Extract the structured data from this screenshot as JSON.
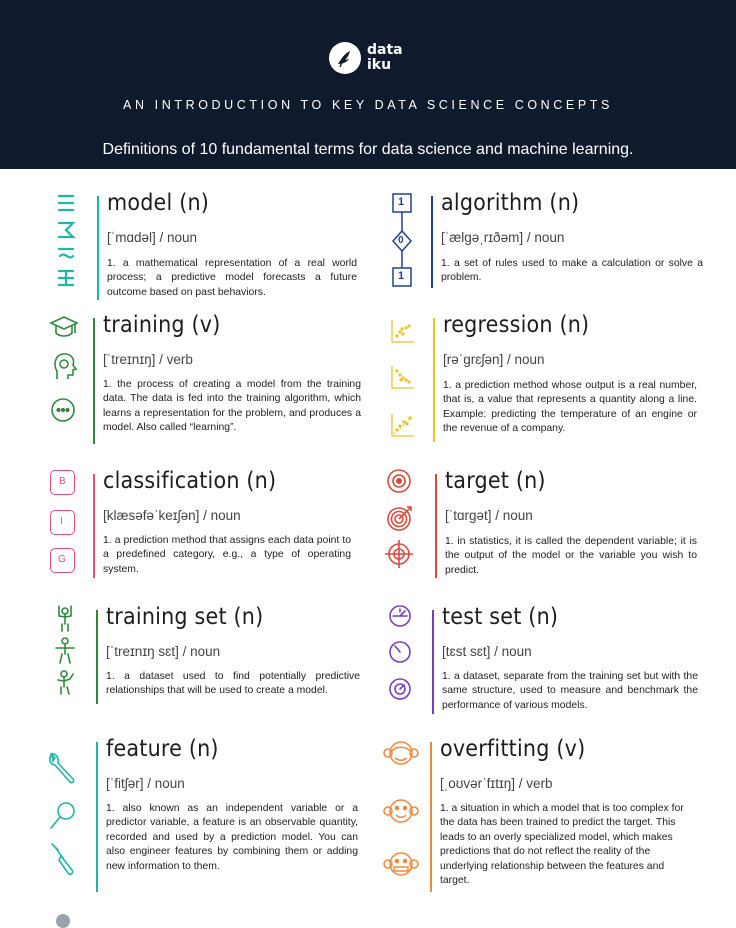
{
  "header": {
    "logo_text_line1": "data",
    "logo_text_line2": "iku",
    "kicker": "AN INTRODUCTION TO KEY DATA SCIENCE CONCEPTS",
    "subtitle": "Definitions of 10 fundamental terms for data science and machine learning."
  },
  "colors": {
    "header_bg": "#0f1a2c",
    "teal": "#1fb6a7",
    "blue": "#24408f",
    "green": "#2e8b3e",
    "yellow": "#e8c52c",
    "pink": "#e2547b",
    "red": "#d94a3f",
    "purple": "#7a3fc0",
    "orange": "#f0883c"
  },
  "terms": [
    {
      "word": "model (n)",
      "pron": "[ˈmɑdəl]  /  noun",
      "def": "1.  a mathematical representation of a real world process; a predictive model forecasts a future outcome based on past behaviors."
    },
    {
      "word": "algorithm (n)",
      "pron": "[ˈælgəˌrɪðəm]  /  noun",
      "def": "1. a set of rules used to make a calculation or solve a problem."
    },
    {
      "word": "training (v)",
      "pron": "[ˈtreɪnɪŋ]  /  verb",
      "def": "1. the process of creating a model from the training data. The data is fed into the training algorithm, which learns a representation for the problem, and produces a model. Also called “learning”."
    },
    {
      "word": "regression (n)",
      "pron": "[rəˈgrɛʃən]  /  noun",
      "def": "1.  a prediction method whose output is a real number, that is, a value that represents a quantity along a line. Example: predicting the temperature of an engine or the revenue of a company."
    },
    {
      "word": "classification (n)",
      "pron": "[klæsəfəˈkeɪʃən]  /  noun",
      "def": "1.  a prediction method that assigns each data point to a predefined category, e.g., a type of operating system."
    },
    {
      "word": "target (n)",
      "pron": "[ˈtɑrgət]  /  noun",
      "def": "1. in statistics, it is called the dependent variable; it is the output of the model or the variable you wish to predict."
    },
    {
      "word": "training set (n)",
      "pron": "[ˈtreɪnɪŋ sɛt]  /  noun",
      "def": "1.  a dataset used to find potentially predictive relationships that will be used to create a model."
    },
    {
      "word": "test set (n)",
      "pron": "[tɛst sɛt]  /  noun",
      "def": "1.  a dataset, separate from the training set but with the same structure, used to measure and benchmark the performance of various models."
    },
    {
      "word": "feature (n)",
      "pron": "[ˈfitʃər]  /  noun",
      "def": "1.  also known as an independent variable or a predictor variable, a feature is an observable quantity, recorded and used by a prediction model. You can also engineer features by combining them or adding new information to them."
    },
    {
      "word": "overfitting (v)",
      "pron": "[ˌoʊvərˈfɪtɪŋ]  /  verb",
      "def": "1. a situation in which a model that is too complex for the data has been trained to predict the target. This leads to an overly specialized model, which makes predictions that do not reflect the reality of the underlying relationship between the features and target."
    }
  ],
  "icons": {
    "algorithm_box_1": "1",
    "algorithm_diamond": "0",
    "algorithm_box_2": "1",
    "class_b": "B",
    "class_i": "I",
    "class_g": "G"
  }
}
